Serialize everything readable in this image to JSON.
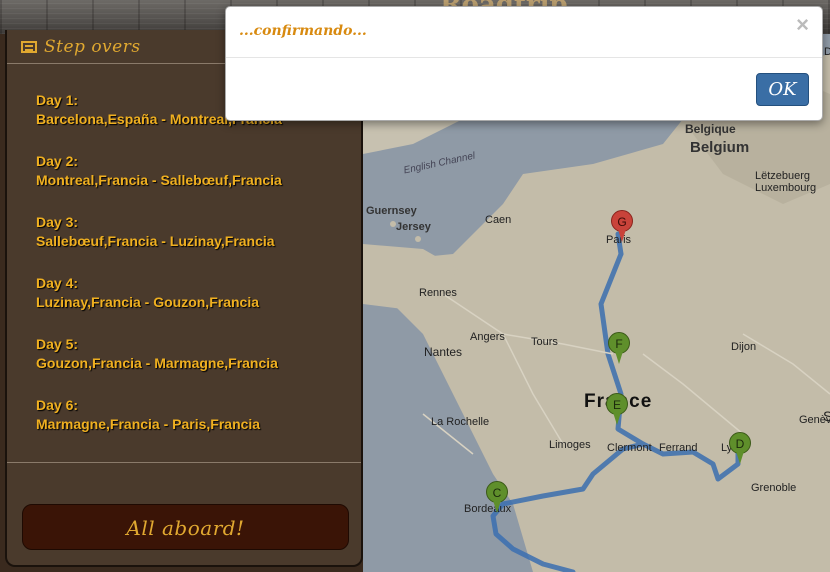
{
  "header": {
    "logo_text": "Roadtrip"
  },
  "sidebar": {
    "title": "Step overs",
    "days": [
      {
        "label": "Day 1:",
        "route": "Barcelona,España - Montreal,Francia"
      },
      {
        "label": "Day 2:",
        "route": "Montreal,Francia - Sallebœuf,Francia"
      },
      {
        "label": "Day 3:",
        "route": "Sallebœuf,Francia - Luzinay,Francia"
      },
      {
        "label": "Day 4:",
        "route": "Luzinay,Francia - Gouzon,Francia"
      },
      {
        "label": "Day 5:",
        "route": "Gouzon,Francia - Marmagne,Francia"
      },
      {
        "label": "Day 6:",
        "route": "Marmagne,Francia - Paris,Francia"
      }
    ],
    "aboard_button": "All aboard!"
  },
  "modal": {
    "title": "...confirmando...",
    "close_glyph": "×",
    "ok_label": "OK"
  },
  "map": {
    "labels": {
      "belgique": "Belgique",
      "belgium": "Belgium",
      "letzebuerg": "Lëtzebuerg",
      "luxembourg": "Luxembourg",
      "english_channel": "English Channel",
      "guernsey": "Guernsey",
      "jersey": "Jersey",
      "caen": "Caen",
      "paris": "Paris",
      "rennes": "Rennes",
      "angers": "Angers",
      "tours": "Tours",
      "dijon": "Dijon",
      "nantes": "Nantes",
      "france": "France",
      "geneve": "Genève",
      "la_rochelle": "La Rochelle",
      "limoges": "Limoges",
      "clermont": "Clermont",
      "ferrand": "Ferrand",
      "lyon": "Ly",
      "grenoble": "Grenoble",
      "bordeaux": "Bordeaux",
      "edge_d": "D",
      "edge_s": "S"
    },
    "markers": [
      "G",
      "F",
      "E",
      "D",
      "C"
    ],
    "colors": {
      "route": "#3b6fb0",
      "marker_green": "#5f8f2b",
      "marker_red": "#c9433a"
    }
  }
}
